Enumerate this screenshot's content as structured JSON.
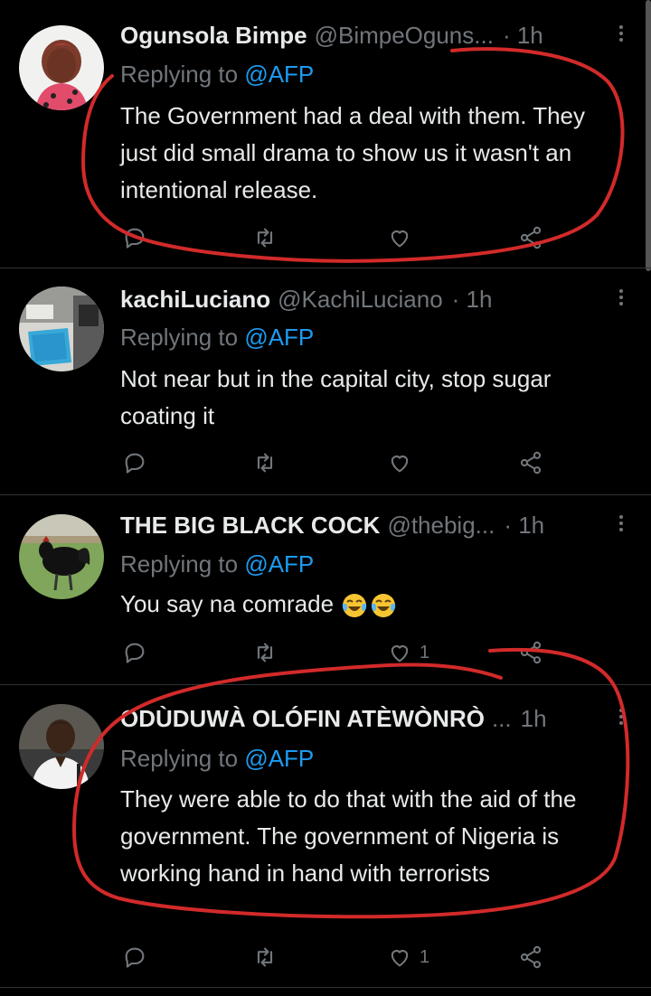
{
  "tweets": [
    {
      "name": "Ogunsola Bimpe",
      "handle": "@BimpeOguns...",
      "time": "· 1h",
      "replying_prefix": "Replying to ",
      "replying_to": "@AFP",
      "text": "The Government had a deal with them. They just did small drama to show us it wasn't an intentional release.",
      "likes": ""
    },
    {
      "name": "kachiLuciano",
      "handle": "@KachiLuciano",
      "time": "· 1h",
      "replying_prefix": "Replying to ",
      "replying_to": "@AFP",
      "text": "Not near but in the capital city, stop sugar coating it",
      "likes": ""
    },
    {
      "name": "THE BIG BLACK COCK",
      "handle": "@thebig...",
      "time": "· 1h",
      "replying_prefix": "Replying to ",
      "replying_to": "@AFP",
      "text": "You say na comrade",
      "likes": "1"
    },
    {
      "name": "ODÙDUWÀ OLÓFIN ATÈWÒNRÒ",
      "handle": "...",
      "time": "1h",
      "replying_prefix": "Replying to ",
      "replying_to": "@AFP",
      "text": "They were able to do that with the aid of the government. The government of Nigeria is working hand in hand with terrorists",
      "likes": "1"
    }
  ],
  "icons": {
    "reply": "reply-icon",
    "retweet": "retweet-icon",
    "like": "heart-icon",
    "share": "share-icon",
    "more": "more-options-icon",
    "emoji": "face-with-tears-of-joy-emoji"
  },
  "colors": {
    "background": "#000000",
    "text": "#e7e9ea",
    "muted": "#71767b",
    "mention": "#1d9bf0",
    "annotation": "#d22a2a"
  }
}
